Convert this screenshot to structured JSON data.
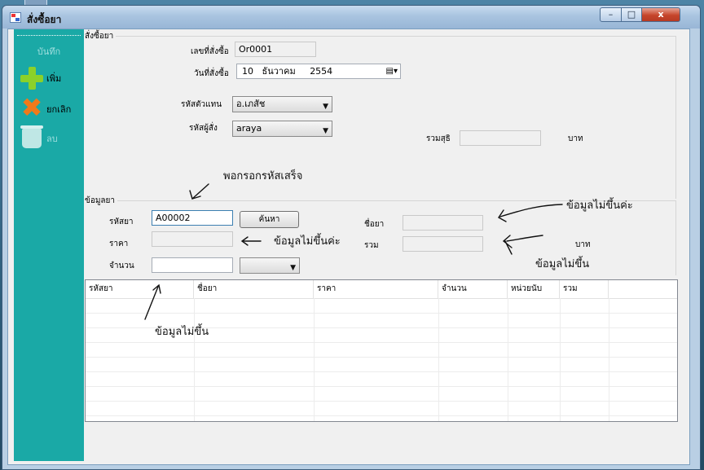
{
  "window": {
    "title": "สั่งซื้อยา",
    "min": "–",
    "max": "□",
    "close": "x"
  },
  "sidebar": {
    "header": "บันทึก",
    "items": [
      {
        "label": "เพิ่ม",
        "icon": "plus-icon"
      },
      {
        "label": "ยกเลิก",
        "icon": "x-icon"
      },
      {
        "label": "ลบ",
        "icon": "recycle-bin-icon"
      }
    ]
  },
  "order": {
    "group_title": "สั่งซื้อยา",
    "order_no_label": "เลขที่สั่งซื้อ",
    "order_no_value": "Or0001",
    "date_label": "วันที่สั่งซื้อ",
    "date_day": "10",
    "date_month": "ธันวาคม",
    "date_year": "2554",
    "agent_label": "รหัสตัวแทน",
    "agent_value": "อ.เภสัช",
    "buyer_label": "รหัสผู้สั่ง",
    "buyer_value": "araya",
    "total_label": "รวมสุธิ",
    "total_value": "",
    "total_unit": "บาท"
  },
  "drug": {
    "group_title": "ข้อมูลยา",
    "code_label": "รหัสยา",
    "code_value": "A00002",
    "search_button": "ค้นหา",
    "name_label": "ชื่อยา",
    "name_value": "",
    "price_label": "ราคา",
    "price_value": "",
    "sum_label": "รวม",
    "sum_value": "",
    "sum_unit": "บาท",
    "qty_label": "จำนวน",
    "qty_value": "",
    "unit_value": ""
  },
  "grid": {
    "columns": [
      "รหัสยา",
      "ชื่อยา",
      "ราคา",
      "จำนวน",
      "หน่วยนับ",
      "รวม"
    ],
    "rows": []
  },
  "annotations": {
    "a1": "พอกรอกรหัสเสร็จ",
    "a2": "ข้อมูลไม่ขึ้นค่ะ",
    "a3": "ข้อมูลไม่ขึ้นค่ะ",
    "a4": "ข้อมูลไม่ขึ้น",
    "a5": "ข้อมูลไม่ขึ้น"
  },
  "colors": {
    "sidebar": "#1aa9a6",
    "titlebar": "#a9c4e0",
    "close": "#c6452b"
  }
}
